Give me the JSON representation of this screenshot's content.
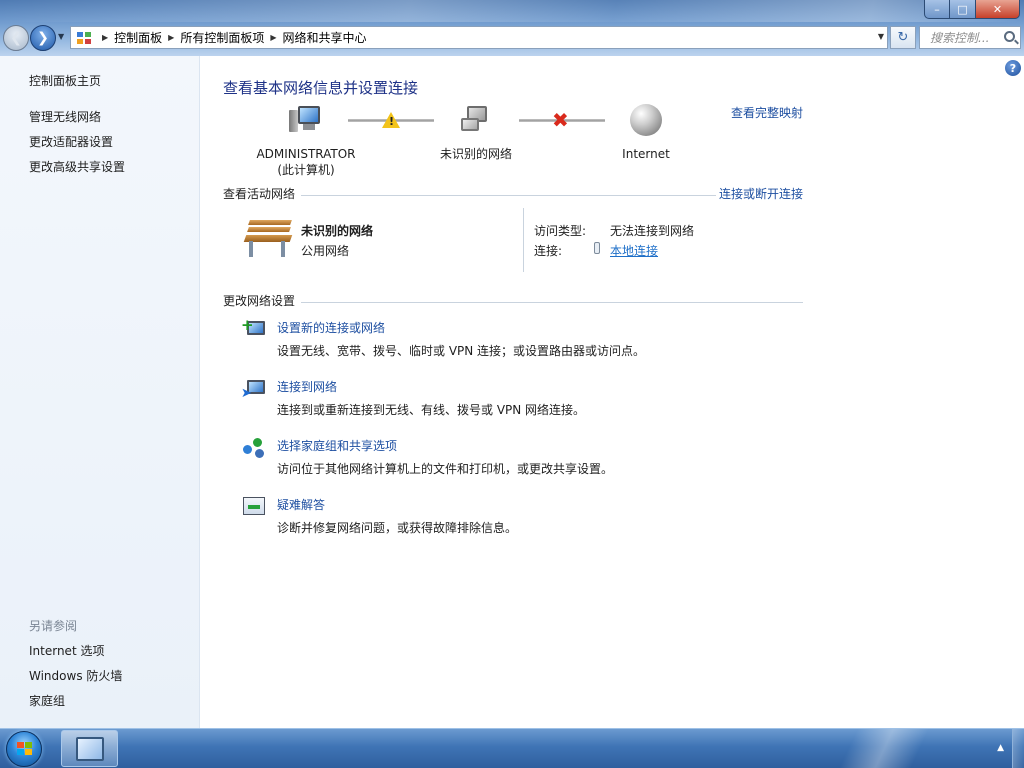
{
  "window": {
    "minimize": "–",
    "maximize": "□",
    "close": "✕"
  },
  "address_bar": {
    "breadcrumbs": [
      "控制面板",
      "所有控制面板项",
      "网络和共享中心"
    ],
    "search_placeholder": "搜索控制..."
  },
  "sidebar": {
    "home_link": "控制面板主页",
    "links": [
      "管理无线网络",
      "更改适配器设置",
      "更改高级共享设置"
    ],
    "see_also_heading": "另请参阅",
    "see_also": [
      "Internet 选项",
      "Windows 防火墙",
      "家庭组"
    ]
  },
  "main": {
    "title": "查看基本网络信息并设置连接",
    "full_map_link": "查看完整映射",
    "map": {
      "computer_name": "ADMINISTRATOR",
      "computer_sub": "(此计算机)",
      "network": "未识别的网络",
      "internet": "Internet",
      "warning_symbol": "!",
      "broken_symbol": "✖"
    },
    "active_networks": {
      "heading": "查看活动网络",
      "connect_link": "连接或断开连接",
      "network_name": "未识别的网络",
      "network_type": "公用网络",
      "access_label": "访问类型:",
      "access_value": "无法连接到网络",
      "connection_label": "连接:",
      "connection_value": "本地连接"
    },
    "change_settings": {
      "heading": "更改网络设置",
      "tasks": [
        {
          "title": "设置新的连接或网络",
          "desc": "设置无线、宽带、拨号、临时或 VPN 连接；或设置路由器或访问点。"
        },
        {
          "title": "连接到网络",
          "desc": "连接到或重新连接到无线、有线、拨号或 VPN 网络连接。"
        },
        {
          "title": "选择家庭组和共享选项",
          "desc": "访问位于其他网络计算机上的文件和打印机，或更改共享设置。"
        },
        {
          "title": "疑难解答",
          "desc": "诊断并修复网络问题，或获得故障排除信息。"
        }
      ]
    }
  },
  "colors": {
    "title_blue": "#1e3287",
    "link_blue": "#1e4fa1",
    "warning_yellow": "#f2c31b",
    "error_red": "#d92a1c"
  }
}
